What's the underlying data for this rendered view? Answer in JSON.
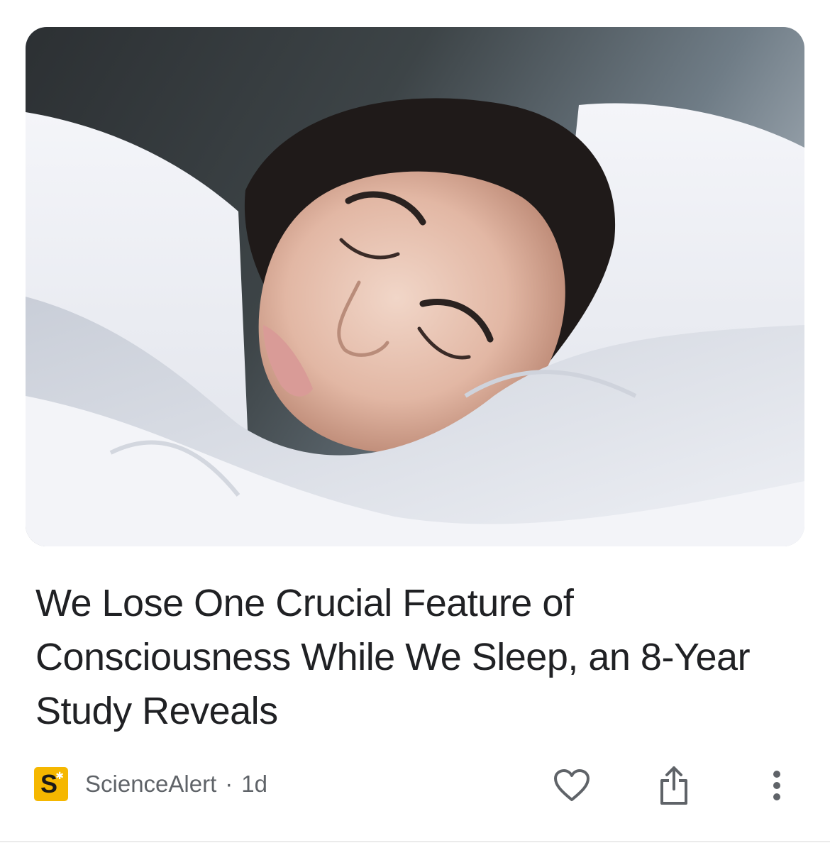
{
  "article": {
    "headline": "We Lose One Crucial Feature of Consciousness While We Sleep, an 8-Year Study Reveals",
    "image_alt": "Woman sleeping under a white duvet"
  },
  "meta": {
    "source_logo_letter": "S",
    "source_name": "ScienceAlert",
    "separator": "·",
    "age": "1d"
  },
  "actions": {
    "like_icon": "heart-icon",
    "share_icon": "share-icon",
    "more_icon": "more-vert-icon"
  },
  "colors": {
    "logo_bg": "#f5b700",
    "text_primary": "#202124",
    "text_secondary": "#5f6368",
    "icon": "#5f6368"
  }
}
